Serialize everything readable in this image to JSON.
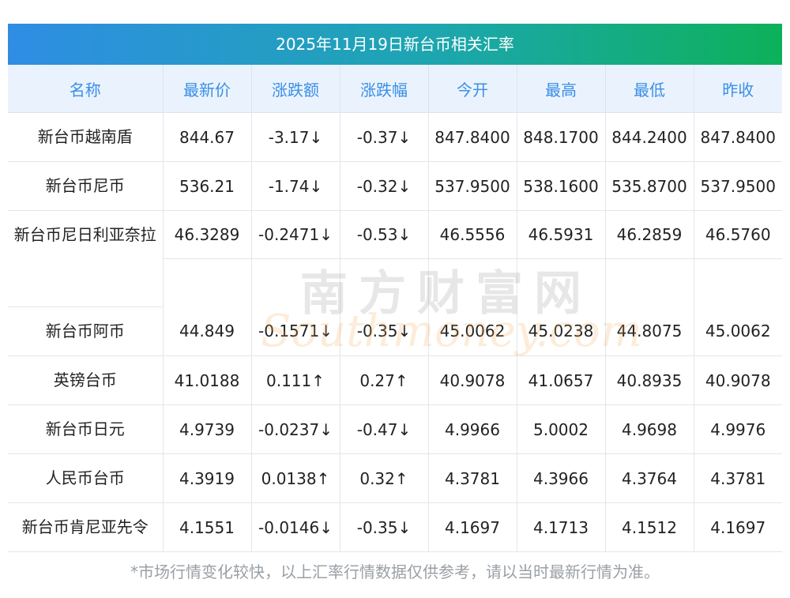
{
  "title": "2025年11月19日新台币相关汇率",
  "headers": [
    "名称",
    "最新价",
    "涨跌额",
    "涨跌幅",
    "今开",
    "最高",
    "最低",
    "昨收"
  ],
  "rows": [
    {
      "name": "新台币越南盾",
      "latest": "844.67",
      "change": "-3.17↓",
      "pct": "-0.37↓",
      "open": "847.8400",
      "high": "848.1700",
      "low": "844.2400",
      "prev": "847.8400",
      "trend": "down"
    },
    {
      "name": "新台币尼币",
      "latest": "536.21",
      "change": "-1.74↓",
      "pct": "-0.32↓",
      "open": "537.9500",
      "high": "538.1600",
      "low": "535.8700",
      "prev": "537.9500",
      "trend": "down"
    },
    {
      "name": "新台币尼日利亚奈拉",
      "latest": "46.3289",
      "change": "-0.2471↓",
      "pct": "-0.53↓",
      "open": "46.5556",
      "high": "46.5931",
      "low": "46.2859",
      "prev": "46.5760",
      "trend": "down"
    },
    {
      "name": "新台币阿币",
      "latest": "44.849",
      "change": "-0.1571↓",
      "pct": "-0.35↓",
      "open": "45.0062",
      "high": "45.0238",
      "low": "44.8075",
      "prev": "45.0062",
      "trend": "down"
    },
    {
      "name": "英镑台币",
      "latest": "41.0188",
      "change": "0.111↑",
      "pct": "0.27↑",
      "open": "40.9078",
      "high": "41.0657",
      "low": "40.8935",
      "prev": "40.9078",
      "trend": "up"
    },
    {
      "name": "新台币日元",
      "latest": "4.9739",
      "change": "-0.0237↓",
      "pct": "-0.47↓",
      "open": "4.9966",
      "high": "5.0002",
      "low": "4.9698",
      "prev": "4.9976",
      "trend": "down"
    },
    {
      "name": "人民币台币",
      "latest": "4.3919",
      "change": "0.0138↑",
      "pct": "0.32↑",
      "open": "4.3781",
      "high": "4.3966",
      "low": "4.3764",
      "prev": "4.3781",
      "trend": "up"
    },
    {
      "name": "新台币肯尼亚先令",
      "latest": "4.1551",
      "change": "-0.0146↓",
      "pct": "-0.35↓",
      "open": "4.1697",
      "high": "4.1713",
      "low": "4.1512",
      "prev": "4.1697",
      "trend": "down"
    }
  ],
  "watermark": {
    "cn": "南方财富网",
    "en": "Southmoney.com"
  },
  "disclaimer": "*市场行情变化较快，以上汇率行情数据仅供参考，请以当时最新行情为准。",
  "colors": {
    "up": "#e8261c",
    "down": "#1a8a1a",
    "header_text": "#3a8ee6"
  }
}
